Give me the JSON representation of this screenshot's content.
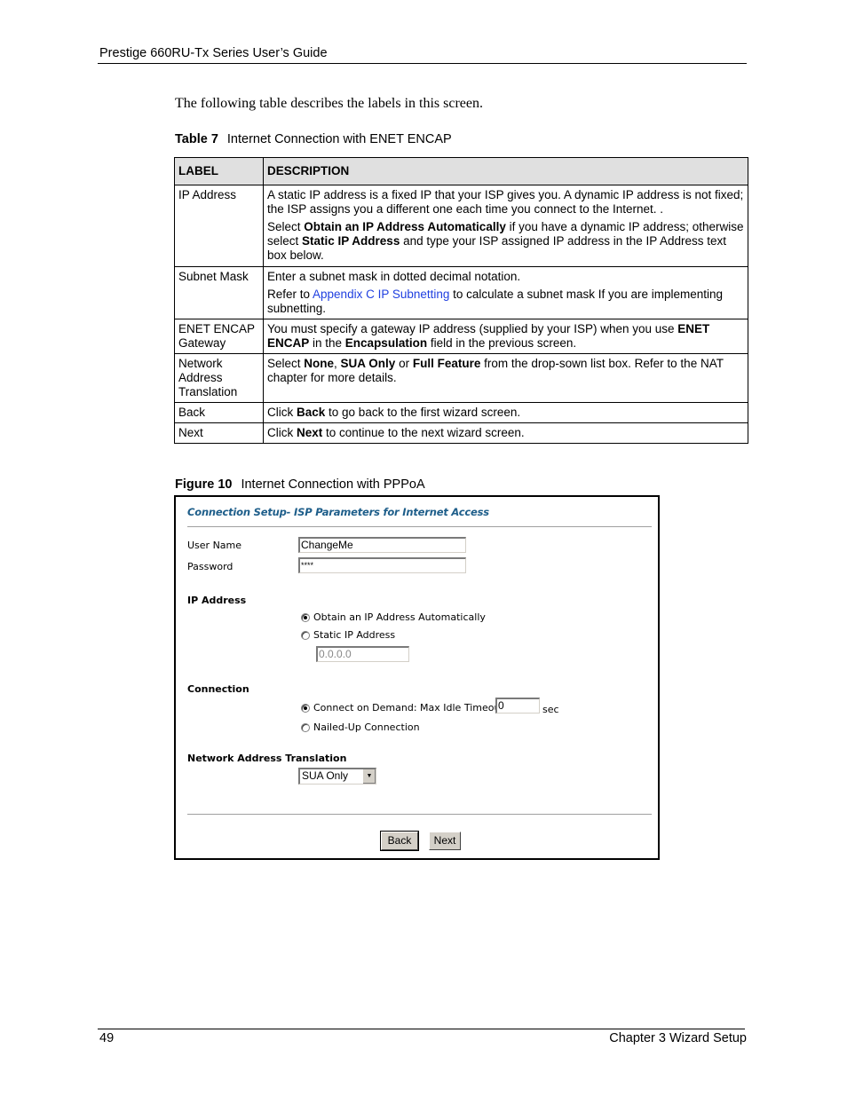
{
  "header": {
    "title": "Prestige 660RU-Tx Series User’s Guide"
  },
  "intro": "The following table describes the labels in this screen.",
  "table": {
    "caption_num": "Table 7",
    "caption_text": "Internet Connection with ENET ENCAP",
    "columns": [
      "LABEL",
      "DESCRIPTION"
    ],
    "rows": [
      {
        "label": "IP Address",
        "p1": "A static IP address is a fixed IP that your ISP gives you. A dynamic IP address is not fixed; the ISP assigns you a different one each time you connect to the Internet. .",
        "p2_a": "Select ",
        "p2_b": "Obtain an IP Address Automatically",
        "p2_c": " if you have a dynamic IP address; otherwise select ",
        "p2_d": "Static IP Address",
        "p2_e": " and type your ISP assigned IP address in the IP Address text box below."
      },
      {
        "label": "Subnet Mask",
        "p1": "Enter a subnet mask in dotted decimal notation.",
        "p2_a": "Refer to ",
        "p2_link": "Appendix C IP Subnetting",
        "p2_b": " to calculate a subnet mask If you are implementing subnetting."
      },
      {
        "label": "ENET ENCAP Gateway",
        "a": "You must specify a gateway IP address (supplied by your ISP) when you use ",
        "b": "ENET ENCAP",
        "c": " in the ",
        "d": "Encapsulation",
        "e": " field in the previous screen."
      },
      {
        "label": "Network Address Translation",
        "a": "Select ",
        "b": "None",
        "c": ", ",
        "d": "SUA Only",
        "e": " or ",
        "f": "Full Feature",
        "g": " from the drop-sown list box. Refer to the NAT chapter for more details."
      },
      {
        "label": "Back",
        "a": "Click ",
        "b": "Back",
        "c": " to go back to the first wizard screen."
      },
      {
        "label": "Next",
        "a": "Click ",
        "b": "Next",
        "c": " to continue to the next wizard screen."
      }
    ]
  },
  "figure": {
    "caption_num": "Figure 10",
    "caption_text": "Internet Connection with PPPoA",
    "title": "Connection Setup- ISP Parameters for Internet Access",
    "user_name_label": "User Name",
    "user_name_value": "ChangeMe",
    "password_label": "Password",
    "password_value": "****",
    "ip_section": "IP Address",
    "ip_auto_label": "Obtain an IP Address Automatically",
    "ip_auto_checked": true,
    "ip_static_label": "Static IP Address",
    "ip_static_value": "0.0.0.0",
    "connection_section": "Connection",
    "on_demand_label": "Connect on Demand: Max Idle Timeout",
    "on_demand_checked": true,
    "idle_timeout_value": "0",
    "idle_timeout_unit": "sec",
    "nailed_up_label": "Nailed-Up Connection",
    "nat_section": "Network Address Translation",
    "nat_value": "SUA Only",
    "back_label": "Back",
    "next_label": "Next"
  },
  "footer": {
    "page": "49",
    "chapter": "Chapter 3 Wizard Setup"
  }
}
